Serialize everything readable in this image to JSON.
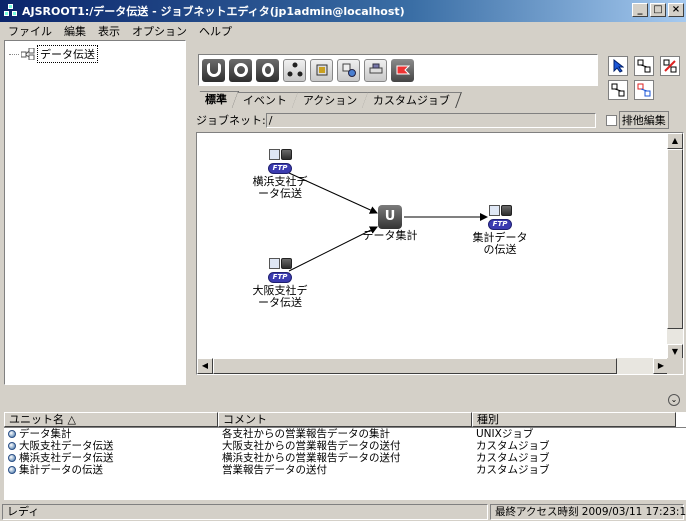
{
  "window": {
    "title": "AJSROOT1:/データ伝送 - ジョブネットエディタ(jp1admin@localhost)",
    "controls": [
      "_",
      "□",
      "×"
    ]
  },
  "menu": [
    "ファイル",
    "編集",
    "表示",
    "オプション",
    "ヘルプ"
  ],
  "tree": {
    "root_label": "データ伝送"
  },
  "palette": {
    "icons": [
      "unix-job-icon",
      "pc-job-icon",
      "queue-job-icon",
      "jobnet-icon",
      "judgment-job-icon",
      "event-icon",
      "action-icon",
      "custom-flag-icon"
    ]
  },
  "tabs": [
    "標準",
    "イベント",
    "アクション",
    "カスタムジョブ"
  ],
  "active_tab": "標準",
  "jobnet": {
    "label": "ジョブネット:",
    "value": "/",
    "exclusive_label": "排他編集"
  },
  "diagram": {
    "nodes": [
      {
        "id": "yokohama",
        "label_line1": "横浜支社デ",
        "label_line2": "ータ伝送",
        "kind": "custom"
      },
      {
        "id": "osaka",
        "label_line1": "大阪支社デ",
        "label_line2": "ータ伝送",
        "kind": "custom"
      },
      {
        "id": "aggregate",
        "label_line1": "データ集計",
        "label_line2": "",
        "kind": "unix"
      },
      {
        "id": "transfer",
        "label_line1": "集計データ",
        "label_line2": "の伝送",
        "kind": "custom"
      }
    ],
    "ftp_label": "FTP",
    "unix_glyph": "U"
  },
  "list": {
    "columns": [
      "ユニット名 △",
      "コメント",
      "種別"
    ],
    "rows": [
      {
        "name": "データ集計",
        "comment": "各支社からの営業報告データの集計",
        "type": "UNIXジョブ"
      },
      {
        "name": "大阪支社データ伝送",
        "comment": "大阪支社からの営業報告データの送付",
        "type": "カスタムジョブ"
      },
      {
        "name": "横浜支社データ伝送",
        "comment": "横浜支社からの営業報告データの送付",
        "type": "カスタムジョブ"
      },
      {
        "name": "集計データの伝送",
        "comment": "営業報告データの送付",
        "type": "カスタムジョブ"
      }
    ]
  },
  "status": {
    "left": "レディ",
    "right": "最終アクセス時刻 2009/03/11 17:23:10"
  }
}
